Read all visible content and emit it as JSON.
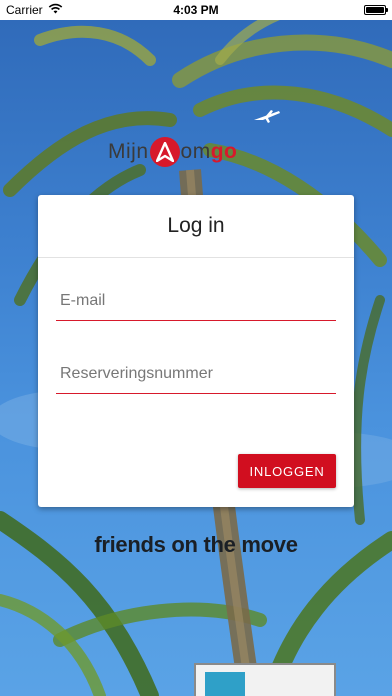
{
  "status_bar": {
    "carrier": "Carrier",
    "time": "4:03 PM",
    "battery_level": 1.0
  },
  "logo": {
    "prefix": "Mijn",
    "middle": "om",
    "suffix": "go"
  },
  "card": {
    "title": "Log in",
    "email_placeholder": "E-mail",
    "reservation_placeholder": "Reserveringsnummer",
    "login_label": "INLOGGEN"
  },
  "tagline": "friends on the move",
  "colors": {
    "accent": "#d7192b",
    "button": "#d10e1f",
    "sky": "#3d80cf"
  },
  "icons": {
    "wifi": "wifi-icon",
    "battery": "battery-icon",
    "plane": "airplane-icon",
    "logo_mark": "logo-arrow-icon"
  }
}
